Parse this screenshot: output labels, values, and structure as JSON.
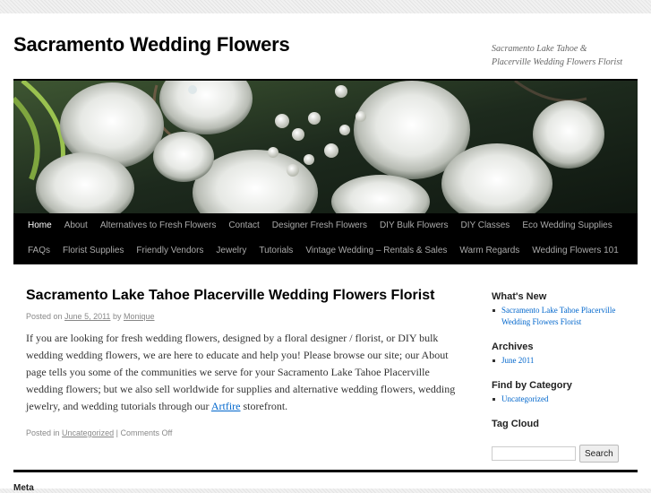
{
  "site": {
    "title": "Sacramento Wedding Flowers",
    "description": "Sacramento Lake Tahoe & Placerville Wedding Flowers Florist"
  },
  "nav": {
    "row1": [
      "Home",
      "About",
      "Alternatives to Fresh Flowers",
      "Contact",
      "Designer Fresh Flowers",
      "DIY Bulk Flowers",
      "DIY Classes",
      "Eco Wedding Supplies"
    ],
    "row2": [
      "FAQs",
      "Florist Supplies",
      "Friendly Vendors",
      "Jewelry",
      "Tutorials",
      "Vintage Wedding – Rentals & Sales",
      "Warm Regards",
      "Wedding Flowers 101"
    ],
    "current": "Home"
  },
  "post": {
    "title": "Sacramento Lake Tahoe Placerville Wedding Flowers Florist",
    "posted_on_label": "Posted on",
    "date": "June 5, 2011",
    "by_label": "by",
    "author": "Monique",
    "body_before_link": "If you are looking for fresh wedding flowers, designed by a floral designer / florist, or DIY bulk wedding wedding flowers, we are here to educate and help you!  Please browse our site; our About page tells you some of the communities we serve for your Sacramento Lake Tahoe Placerville wedding flowers; but we also sell worldwide for supplies and alternative wedding flowers, wedding jewelry, and wedding tutorials through our ",
    "body_link": "Artfire",
    "body_after_link": " storefront.",
    "posted_in_label": "Posted in",
    "category": "Uncategorized",
    "separator": "|",
    "comments": "Comments Off"
  },
  "sidebar": {
    "whats_new": {
      "title": "What's New",
      "items": [
        "Sacramento Lake Tahoe Placerville Wedding Flowers Florist"
      ]
    },
    "archives": {
      "title": "Archives",
      "items": [
        "June 2011"
      ]
    },
    "categories": {
      "title": "Find by Category",
      "items": [
        "Uncategorized"
      ]
    },
    "tag_cloud": {
      "title": "Tag Cloud"
    },
    "search": {
      "value": "",
      "button_label": "Search"
    }
  },
  "footer": {
    "meta_title": "Meta"
  },
  "colors": {
    "link": "#0066cc",
    "nav_bg": "#000000",
    "nav_text": "#aaaaaa"
  }
}
